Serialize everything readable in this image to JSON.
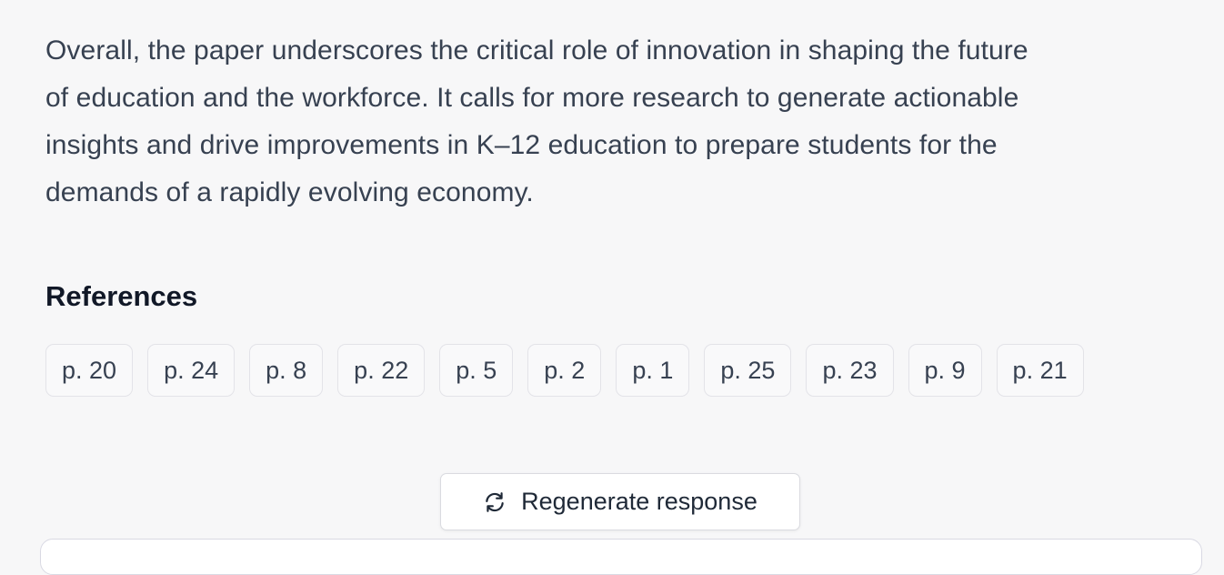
{
  "summary": {
    "line1": "Overall, the paper underscores the critical role of innovation in shaping the future",
    "line2": "of education and the workforce. It calls for more research to generate actionable",
    "line3": "insights and drive improvements in K–12 education to prepare students for the",
    "line4": "demands of a rapidly evolving economy."
  },
  "references": {
    "heading": "References",
    "pages": [
      "p. 20",
      "p. 24",
      "p. 8",
      "p. 22",
      "p. 5",
      "p. 2",
      "p. 1",
      "p. 25",
      "p. 23",
      "p. 9",
      "p. 21"
    ]
  },
  "actions": {
    "regenerate_label": "Regenerate response",
    "regenerate_icon": "refresh-icon"
  }
}
